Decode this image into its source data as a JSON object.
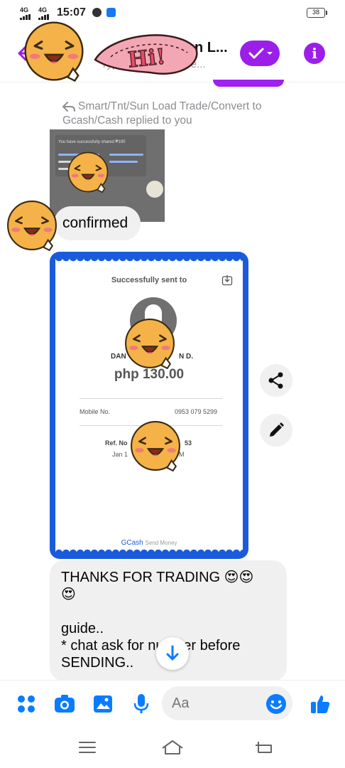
{
  "status_bar": {
    "network_1": "4G",
    "network_2": "4G",
    "time": "15:07",
    "battery": "38"
  },
  "header": {
    "contact_name": "n L...",
    "contact_subtitle_left": "Typically",
    "contact_subtitle_right": "n a fe...",
    "sticker_text": "Hi!",
    "accent_color": "#9b1fe8"
  },
  "thread": {
    "reply_note": "Smart/Tnt/Sun Load Trade/Convert to Gcash/Cash replied to you",
    "quoted_message_text": "You have successfully shared ₱100",
    "confirmed_message": "confirmed",
    "receipt": {
      "title": "Successfully sent to",
      "name_left": "DAN",
      "name_right": "N D.",
      "amount": "php 130.00",
      "mobile_label": "Mobile No.",
      "mobile_number": "0953 079 5299",
      "ref_label": "Ref. No",
      "ref_tail": "53",
      "date_left": "Jan 1",
      "date_right": "M",
      "footer_brand": "GCash",
      "footer_sub": "Send Money",
      "frame_color": "#1a5bdb"
    },
    "thanks_message": "THANKS FOR TRADING 😍😍\n😍\n\nguide..\n* chat ask for number before\nSENDING.."
  },
  "composer": {
    "placeholder": "Aa"
  },
  "icons": {
    "share": "share-icon",
    "edit": "pencil-icon",
    "scroll": "arrow-down-icon",
    "apps": "apps-grid-icon",
    "camera": "camera-icon",
    "gallery": "gallery-icon",
    "mic": "microphone-icon",
    "emoji": "emoji-icon",
    "like": "thumbs-up-icon"
  },
  "colors": {
    "messenger_blue": "#0a7cff",
    "purple": "#9b1fe8"
  }
}
